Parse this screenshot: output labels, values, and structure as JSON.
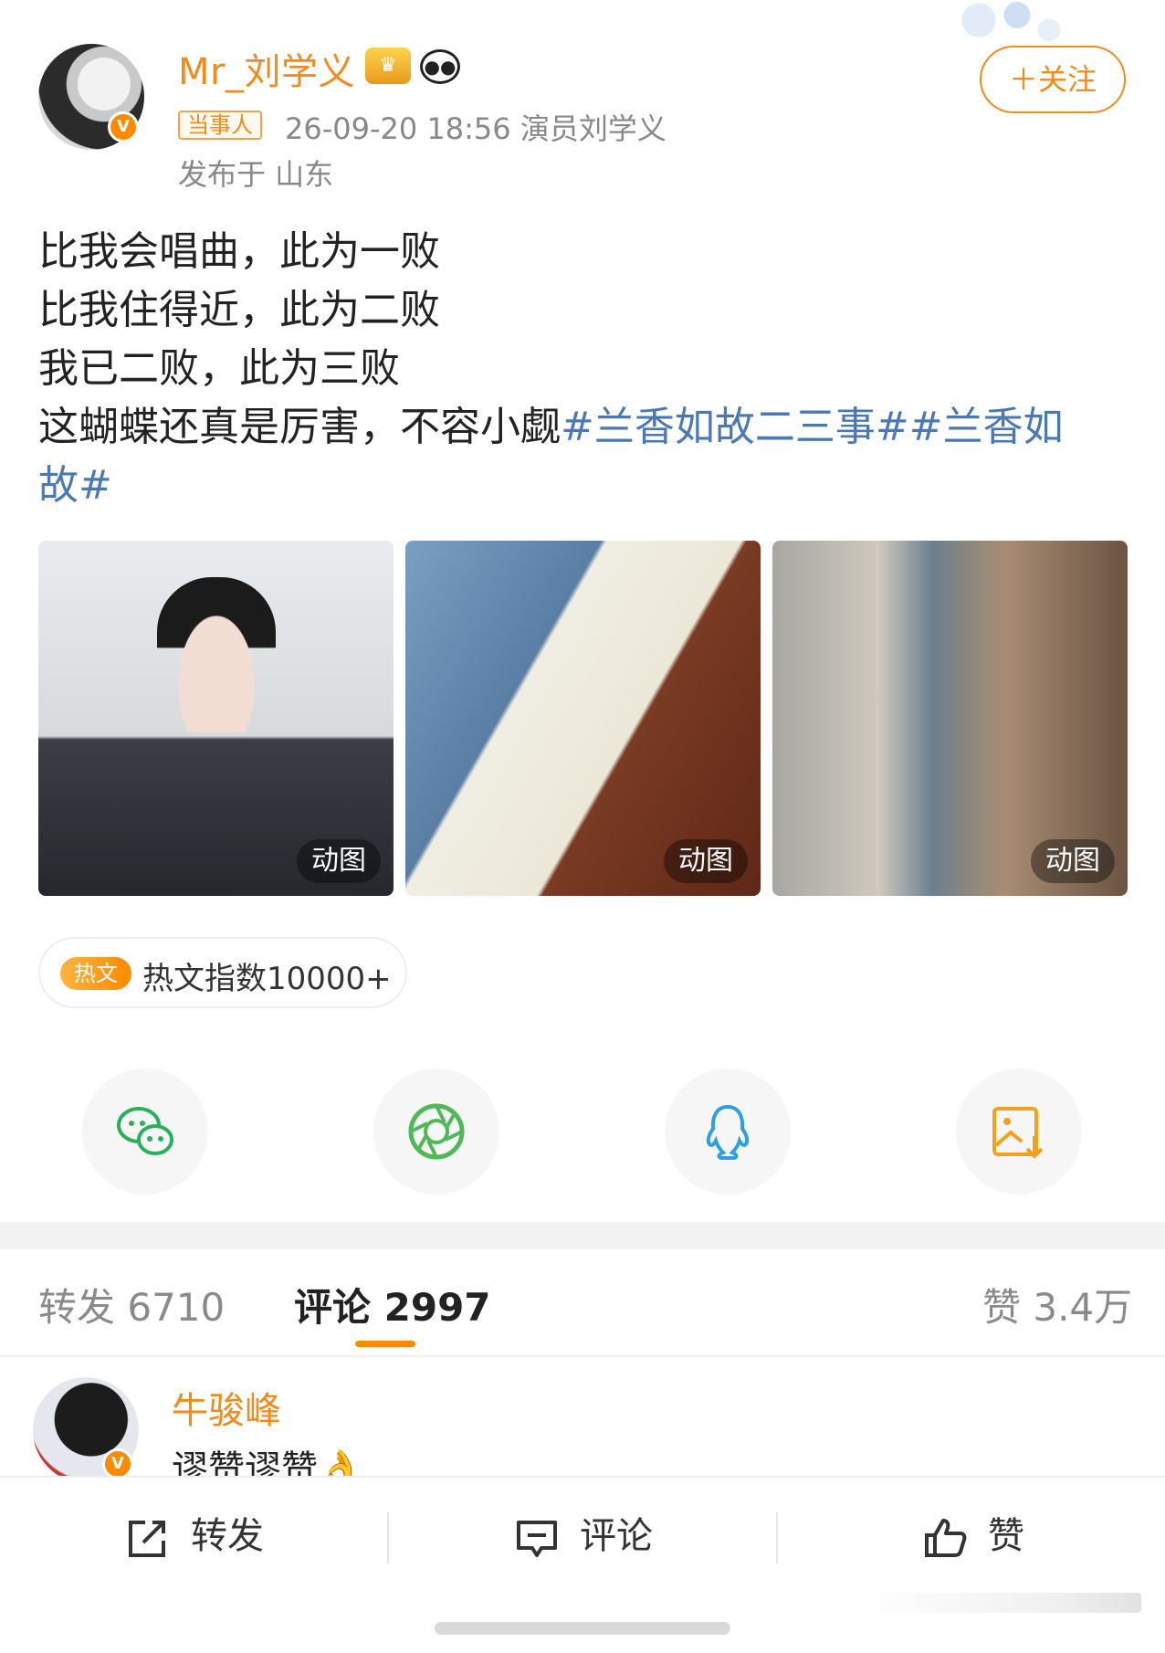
{
  "header": {
    "username": "Mr_刘学义",
    "tag": "当事人",
    "meta": "26-09-20 18:56  演员刘学义",
    "location": "发布于 山东",
    "follow_label": "＋关注",
    "verified_mark": "V"
  },
  "post": {
    "lines": [
      "比我会唱曲，此为一败",
      "比我住得近，此为二败",
      "我已二败，此为三败"
    ],
    "line4_text": "这蝴蝶还真是厉害，不容小觑",
    "line4_hashtag": "#兰香如故二三事##兰香如",
    "line5_hashtag": "故#"
  },
  "media": [
    {
      "badge": "动图"
    },
    {
      "badge": "动图"
    },
    {
      "badge": "动图"
    }
  ],
  "hot": {
    "icon_text": "热文",
    "label": "热文指数10000+"
  },
  "share": [
    {
      "icon": "wechat-icon",
      "color": "#2bb05a"
    },
    {
      "icon": "moments-icon",
      "color": "#51b85a"
    },
    {
      "icon": "qq-icon",
      "color": "#2f9fe0"
    },
    {
      "icon": "save-image-icon",
      "color": "#f2a11c"
    }
  ],
  "tabs": {
    "repost": "转发 6710",
    "comment": "评论 2997",
    "like": "赞 3.4万"
  },
  "comment": {
    "name": "牛骏峰",
    "text": "谬赞谬赞👌"
  },
  "actions": {
    "repost": "转发",
    "comment": "评论",
    "like": "赞"
  },
  "colors": {
    "accent": "#f28a1c",
    "hashtag": "#4a78b7"
  }
}
